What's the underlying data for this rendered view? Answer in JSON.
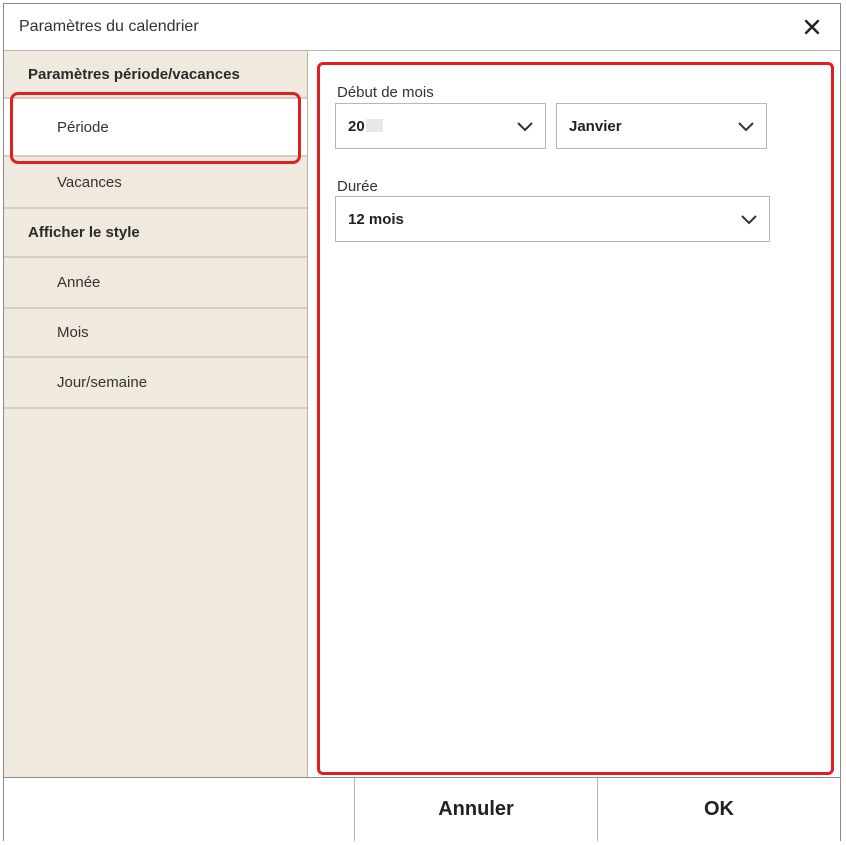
{
  "dialog": {
    "title": "Paramètres du calendrier",
    "close_icon": "close-icon"
  },
  "sidebar": {
    "items": [
      {
        "label": "Paramètres période/vacances",
        "type": "heading"
      },
      {
        "label": "Période",
        "type": "sub",
        "selected": true
      },
      {
        "label": "Vacances",
        "type": "sub"
      },
      {
        "label": "Afficher le style",
        "type": "heading"
      },
      {
        "label": "Année",
        "type": "sub"
      },
      {
        "label": "Mois",
        "type": "sub"
      },
      {
        "label": "Jour/semaine",
        "type": "sub"
      }
    ]
  },
  "content": {
    "start_label": "Début de mois",
    "year_value": "20",
    "month_value": "Janvier",
    "duration_label": "Durée",
    "duration_value": "12 mois"
  },
  "footer": {
    "cancel_label": "Annuler",
    "ok_label": "OK"
  },
  "colors": {
    "highlight": "#e02020",
    "sidebar_bg": "#efe9de"
  }
}
